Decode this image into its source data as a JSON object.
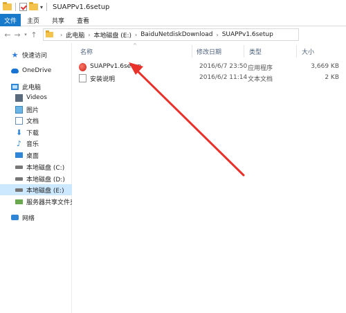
{
  "window": {
    "title": "SUAPPv1.6setup"
  },
  "ribbon": {
    "tabs": [
      "文件",
      "主页",
      "共享",
      "查看"
    ]
  },
  "address": {
    "crumbs": [
      "此电脑",
      "本地磁盘 (E:)",
      "BaiduNetdiskDownload",
      "SUAPPv1.6setup"
    ]
  },
  "nav": {
    "items": [
      {
        "label": "快速访问"
      },
      {
        "label": "OneDrive"
      },
      {
        "label": "此电脑"
      },
      {
        "label": "Videos"
      },
      {
        "label": "图片"
      },
      {
        "label": "文档"
      },
      {
        "label": "下载"
      },
      {
        "label": "音乐"
      },
      {
        "label": "桌面"
      },
      {
        "label": "本地磁盘 (C:)"
      },
      {
        "label": "本地磁盘 (D:)"
      },
      {
        "label": "本地磁盘 (E:)"
      },
      {
        "label": "服务器共享文件夹 ("
      },
      {
        "label": "网络"
      }
    ]
  },
  "columns": {
    "name": "名称",
    "date": "修改日期",
    "type": "类型",
    "size": "大小"
  },
  "files": [
    {
      "name": "SUAPPv1.6setup",
      "date": "2016/6/7 23:50",
      "type": "应用程序",
      "size": "3,669 KB"
    },
    {
      "name": "安装说明",
      "date": "2016/6/2 11:14",
      "type": "文本文档",
      "size": "2 KB"
    }
  ],
  "colors": {
    "file_tab": "#1979ca",
    "selected": "#cce8ff",
    "arrow": "#e8312a"
  }
}
